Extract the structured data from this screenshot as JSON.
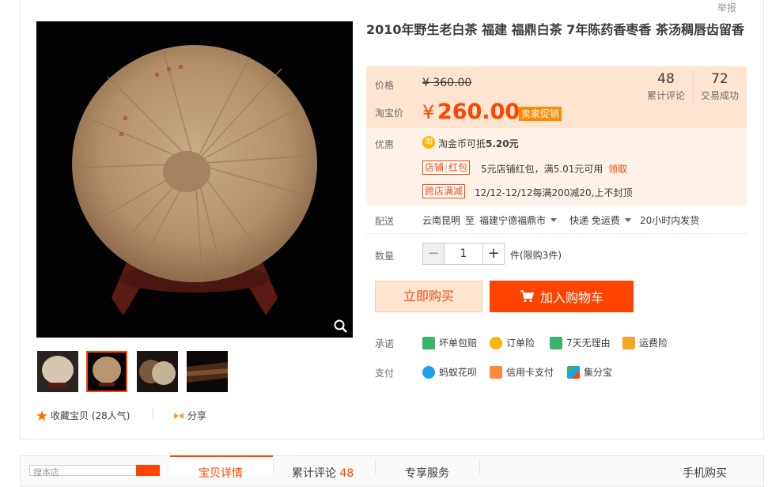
{
  "report_label": "举报",
  "product": {
    "title": "2010年野生老白茶 福建 福鼎白茶 7年陈药香枣香 茶汤稠唇齿留香",
    "price_label": "价格",
    "original_price": "¥ 360.00",
    "tb_price_label": "淘宝价",
    "currency": "¥",
    "price": "260.00",
    "promo_tag": "卖家促销",
    "stats": [
      {
        "num": "48",
        "label": "累计评论"
      },
      {
        "num": "72",
        "label": "交易成功"
      }
    ]
  },
  "discounts": {
    "label": "优惠",
    "coin_icon": "淘",
    "coin_text_prefix": "淘金币可抵",
    "coin_text_amount": "5.20元",
    "shop_tag_a": "店铺",
    "shop_tag_b": "红包",
    "shop_text": "5元店铺红包，满5.01元可用",
    "claim": "领取",
    "cross_tag": "跨店满减",
    "cross_text": "12/12-12/12每满200减20,上不封顶"
  },
  "shipping": {
    "label": "配送",
    "from": "云南昆明",
    "to_word": "至",
    "to": "福建宁德福鼎市",
    "method": "快递 免运费",
    "dispatch": "20小时内发货"
  },
  "quantity": {
    "label": "数量",
    "minus": "−",
    "value": "1",
    "plus": "+",
    "unit": "件(限购3件)"
  },
  "buttons": {
    "buy_now": "立即购买",
    "add_to_cart": "加入购物车"
  },
  "promise": {
    "label": "承诺",
    "items": [
      "坏单包赔",
      "订单险",
      "7天无理由",
      "运费险"
    ]
  },
  "payment": {
    "label": "支付",
    "items": [
      "蚂蚁花呗",
      "信用卡支付",
      "集分宝"
    ]
  },
  "gallery": {
    "favorite": "收藏宝贝 (28人气)",
    "share": "分享"
  },
  "bottom": {
    "search_placeholder": "搜本店",
    "tabs": [
      "宝贝详情",
      "累计评论",
      "专享服务",
      "手机购买"
    ],
    "review_count": "48"
  },
  "colors": {
    "accent": "#ff4400",
    "price_bg": "#fff2e8",
    "buy_now_bg": "#ffe4d0"
  }
}
